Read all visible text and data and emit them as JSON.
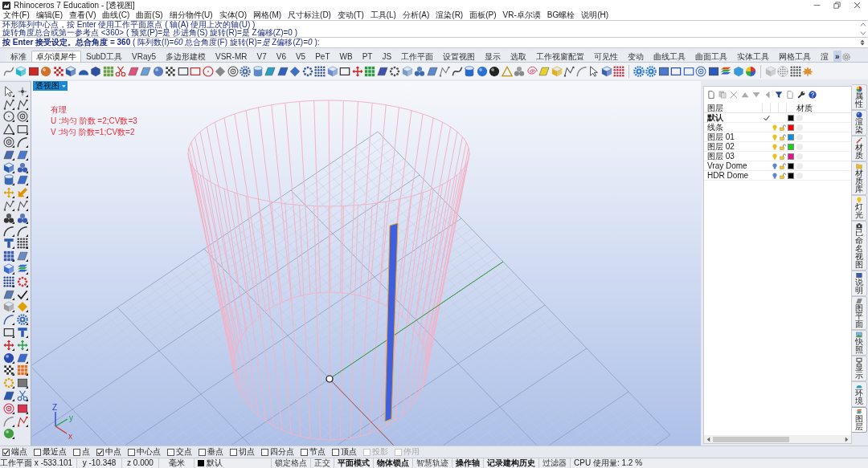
{
  "window": {
    "title": "Rhinoceros 7 Education - [透视图]"
  },
  "menu": [
    "文件(F)",
    "编辑(E)",
    "查看(V)",
    "曲线(C)",
    "曲面(S)",
    "细分物件(U)",
    "实体(O)",
    "网格(M)",
    "尺寸标注(D)",
    "变动(T)",
    "工具(L)",
    "分析(A)",
    "渲染(R)",
    "面板(P)",
    "VR-卓尔谟",
    "BG螺栓",
    "说明(H)"
  ],
  "command_history": [
    "环形阵列中心点，按 Enter 使用工作平面原点 ( 轴(A) 使用上次的轴(U) )",
    "旋转角度总合或第一参考点 <360> ( 预览(P)=是 步进角(S) 旋转(R)=是 Z偏移(Z)=0 )"
  ],
  "command_prompt": "**按 Enter 接受设定。总合角度 = 360** ( 阵列数(I)=*60* 总合角度(F) 旋转(R)=*是* Z偏移(Z)=*0* ):",
  "toolbar_tabs": [
    {
      "label": "标准",
      "selected": false
    },
    {
      "label": "卓尔谟犀牛",
      "selected": true
    },
    {
      "label": "SubD工具",
      "selected": false
    },
    {
      "label": "VRay5",
      "selected": false
    },
    {
      "label": "多边形建模",
      "selected": false
    },
    {
      "label": "VSR-MR",
      "selected": false
    },
    {
      "label": "V7",
      "selected": false
    },
    {
      "label": "V6",
      "selected": false
    },
    {
      "label": "V5",
      "selected": false
    },
    {
      "label": "PeT",
      "selected": false
    },
    {
      "label": "WB",
      "selected": false
    },
    {
      "label": "PT",
      "selected": false
    },
    {
      "label": "JS",
      "selected": false
    },
    {
      "label": "工作平面",
      "selected": false
    },
    {
      "label": "设置视图",
      "selected": false
    },
    {
      "label": "显示",
      "selected": false
    },
    {
      "label": "选取",
      "selected": false
    },
    {
      "label": "工作视窗配置",
      "selected": false
    },
    {
      "label": "可见性",
      "selected": false
    },
    {
      "label": "变动",
      "selected": false
    },
    {
      "label": "曲线工具",
      "selected": false
    },
    {
      "label": "曲面工具",
      "selected": false
    },
    {
      "label": "实体工具",
      "selected": false
    },
    {
      "label": "网格工具",
      "selected": false
    },
    {
      "label": "渲",
      "selected": false
    }
  ],
  "more_tabs": "»",
  "viewport": {
    "title": "透视图",
    "surface_info": [
      "有理",
      "U :均匀 阶数 =2;CV数=3",
      "V :均匀 阶数=1;CV数=2"
    ],
    "axes": [
      {
        "kind": "z",
        "label": "Z"
      },
      {
        "kind": "y",
        "label": "y"
      },
      {
        "kind": "x",
        "label": "x"
      }
    ]
  },
  "layers_panel": {
    "columns": [
      "图层",
      "材质"
    ],
    "layers": [
      {
        "name": "默认",
        "current": true,
        "color": "#000000"
      },
      {
        "name": "线条",
        "current": false,
        "bulb": {
          "color": "#e8c020"
        },
        "locked": false,
        "color": "#ff0000"
      },
      {
        "name": "图层 01",
        "current": false,
        "bulb": {
          "color": "#e8c020"
        },
        "locked": false,
        "color": "#0a8ee8"
      },
      {
        "name": "图层 02",
        "current": false,
        "bulb": {
          "color": "#e8c020"
        },
        "locked": false,
        "color": "#18d018"
      },
      {
        "name": "图层 03",
        "current": false,
        "bulb": {
          "color": "#e8c020"
        },
        "locked": false,
        "color": "#e8108a"
      },
      {
        "name": "Vray Dome",
        "current": false,
        "bulb": {
          "color": "#5a88d0"
        },
        "locked": false,
        "color": "#000000"
      },
      {
        "name": "HDR Dome",
        "current": false,
        "bulb": {
          "color": "#5a88d0"
        },
        "locked": false,
        "color": "#000000"
      }
    ]
  },
  "side_tabs": [
    {
      "label": "属性",
      "selected": false
    },
    {
      "label": "渲染",
      "selected": false
    },
    {
      "label": "材质",
      "selected": false
    },
    {
      "label": "材质库",
      "selected": false
    },
    {
      "label": "灯光",
      "selected": false
    },
    {
      "label": "已命名视图",
      "selected": false
    },
    {
      "label": "说明",
      "selected": false
    },
    {
      "label": "图平面",
      "selected": false
    },
    {
      "label": "快照",
      "selected": false
    },
    {
      "label": "显示",
      "selected": false
    },
    {
      "label": "环境",
      "selected": false
    },
    {
      "label": "图层",
      "selected": true
    }
  ],
  "osnaps": [
    {
      "label": "端点",
      "checked": true,
      "disabled": false
    },
    {
      "label": "最近点",
      "checked": false,
      "disabled": false
    },
    {
      "label": "点",
      "checked": false,
      "disabled": false
    },
    {
      "label": "中点",
      "checked": true,
      "disabled": false
    },
    {
      "label": "中心点",
      "checked": false,
      "disabled": false
    },
    {
      "label": "交点",
      "checked": false,
      "disabled": false
    },
    {
      "label": "垂点",
      "checked": false,
      "disabled": false
    },
    {
      "label": "切点",
      "checked": false,
      "disabled": false
    },
    {
      "label": "四分点",
      "checked": false,
      "disabled": false
    },
    {
      "label": "节点",
      "checked": false,
      "disabled": false
    },
    {
      "label": "顶点",
      "checked": false,
      "disabled": false
    },
    {
      "label": "投影",
      "checked": false,
      "disabled": true
    },
    {
      "label": "停用",
      "checked": false,
      "disabled": true
    }
  ],
  "status_bar": {
    "cplane": "工作平面",
    "x": "x -533.101",
    "y": "y -10.348",
    "z": "z 0.000",
    "units": "毫米",
    "layer": {
      "name": "默认",
      "color": "#000000"
    },
    "toggles": [
      {
        "label": "锁定格点",
        "on": false
      },
      {
        "label": "正交",
        "on": false
      },
      {
        "label": "平面模式",
        "on": true
      },
      {
        "label": "物体锁点",
        "on": true
      },
      {
        "label": "智慧轨迹",
        "on": false
      },
      {
        "label": "操作轴",
        "on": true
      },
      {
        "label": "记录建构历史",
        "on": true
      },
      {
        "label": "过滤器",
        "on": false
      }
    ],
    "cpu": "CPU 使用量: 1.2 %"
  }
}
